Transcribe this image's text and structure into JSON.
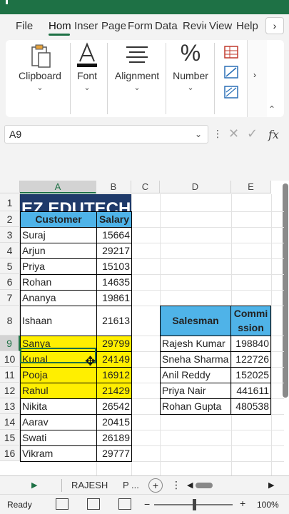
{
  "tabs": [
    "File",
    "Home",
    "Insert",
    "Page Layout",
    "Formulas",
    "Data",
    "Review",
    "View",
    "Help"
  ],
  "tab_display": [
    "File",
    "Hom",
    "Inser",
    "Page",
    "Form",
    "Data",
    "Revie",
    "View",
    "Help"
  ],
  "ribbon": {
    "groups": [
      {
        "label": "Clipboard",
        "icon": "clipboard-icon"
      },
      {
        "label": "Font",
        "icon": "font-icon"
      },
      {
        "label": "Alignment",
        "icon": "alignment-icon"
      },
      {
        "label": "Number",
        "icon": "percent-icon"
      }
    ]
  },
  "name_box": "A9",
  "columns": [
    "A",
    "B",
    "C",
    "D",
    "E"
  ],
  "rows": [
    "1",
    "2",
    "3",
    "4",
    "5",
    "6",
    "7",
    "8",
    "9",
    "10",
    "11",
    "12",
    "13",
    "14",
    "15",
    "16"
  ],
  "banner": "EZ EDUTECH",
  "table_headers": {
    "customer": "Customer",
    "salary": "Salary"
  },
  "customers": [
    {
      "name": "Suraj",
      "salary": "15664"
    },
    {
      "name": "Arjun",
      "salary": "29217"
    },
    {
      "name": "Priya",
      "salary": "15103"
    },
    {
      "name": "Rohan",
      "salary": "14635"
    },
    {
      "name": "Ananya",
      "salary": "19861"
    },
    {
      "name": "Ishaan",
      "salary": "21613"
    },
    {
      "name": "Sanya",
      "salary": "29799"
    },
    {
      "name": "Kunal",
      "salary": "24149"
    },
    {
      "name": "Pooja",
      "salary": "16912"
    },
    {
      "name": "Rahul",
      "salary": "21429"
    },
    {
      "name": "Nikita",
      "salary": "26542"
    },
    {
      "name": "Aarav",
      "salary": "20415"
    },
    {
      "name": "Swati",
      "salary": "26189"
    },
    {
      "name": "Vikram",
      "salary": "29777"
    }
  ],
  "highlight_color": "#ffef00",
  "header_color": "#4fb3e8",
  "banner_color": "#1f3a6a",
  "accent_color": "#1e7145",
  "comm_headers": {
    "salesman": "Salesman",
    "commission_line1": "Commi",
    "commission_line2": "ssion"
  },
  "commission": [
    {
      "name": "Rajesh Kumar",
      "value": "198840"
    },
    {
      "name": "Sneha Sharma",
      "value": "122726"
    },
    {
      "name": "Anil Reddy",
      "value": "152025"
    },
    {
      "name": "Priya Nair",
      "value": "441611"
    },
    {
      "name": "Rohan Gupta",
      "value": "480538"
    }
  ],
  "sheet_tabs": [
    "RAJESH",
    "P ..."
  ],
  "status": {
    "ready": "Ready",
    "zoom": "100%"
  }
}
